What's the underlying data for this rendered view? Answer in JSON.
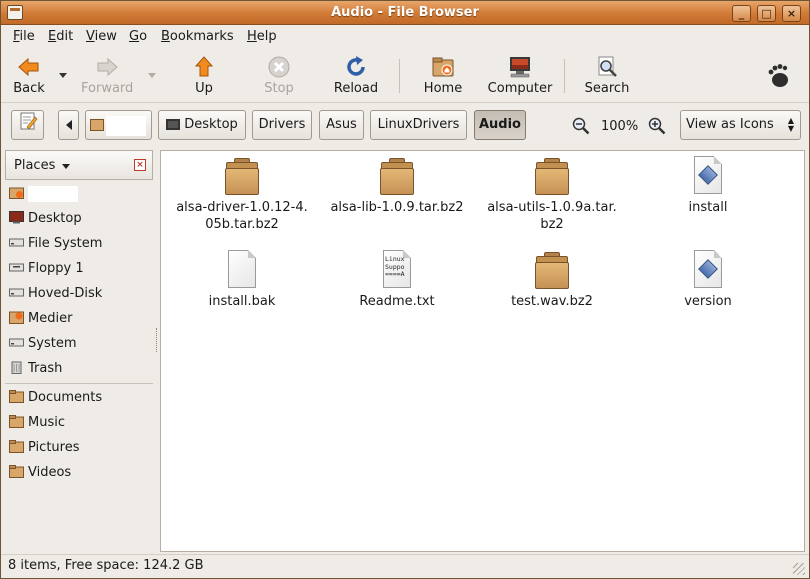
{
  "window": {
    "title": "Audio - File Browser"
  },
  "menu": [
    {
      "label": "File",
      "mnemonic": "F",
      "rest": "ile"
    },
    {
      "label": "Edit",
      "mnemonic": "E",
      "rest": "dit"
    },
    {
      "label": "View",
      "mnemonic": "V",
      "rest": "iew"
    },
    {
      "label": "Go",
      "mnemonic": "G",
      "rest": "o"
    },
    {
      "label": "Bookmarks",
      "mnemonic": "B",
      "rest": "ookmarks"
    },
    {
      "label": "Help",
      "mnemonic": "H",
      "rest": "elp"
    }
  ],
  "toolbar": {
    "back": "Back",
    "forward": "Forward",
    "up": "Up",
    "stop": "Stop",
    "reload": "Reload",
    "home": "Home",
    "computer": "Computer",
    "search": "Search"
  },
  "location": {
    "crumbs": [
      "Desktop",
      "Drivers",
      "Asus",
      "LinuxDrivers",
      "Audio"
    ],
    "active": "Audio",
    "zoom": "100%",
    "view_mode": "View as Icons"
  },
  "sidebar": {
    "header": "Places",
    "items": [
      {
        "label": "",
        "icon": "home-folder-icon"
      },
      {
        "label": "Desktop",
        "icon": "desktop-icon"
      },
      {
        "label": "File System",
        "icon": "drive-icon"
      },
      {
        "label": "Floppy 1",
        "icon": "floppy-icon"
      },
      {
        "label": "Hoved-Disk",
        "icon": "drive-icon"
      },
      {
        "label": "Medier",
        "icon": "media-icon"
      },
      {
        "label": "System",
        "icon": "drive-icon"
      },
      {
        "label": "Trash",
        "icon": "trash-icon"
      }
    ],
    "bookmarks": [
      {
        "label": "Documents",
        "icon": "folder-icon"
      },
      {
        "label": "Music",
        "icon": "folder-icon"
      },
      {
        "label": "Pictures",
        "icon": "folder-icon"
      },
      {
        "label": "Videos",
        "icon": "folder-icon"
      }
    ]
  },
  "files": [
    {
      "name": "alsa-driver-1.0.12-4.05b.tar.bz2",
      "line1": "alsa-driver-1.0.12-4.",
      "line2": "05b.tar.bz2",
      "type": "archive"
    },
    {
      "name": "alsa-lib-1.0.9.tar.bz2",
      "line1": "alsa-lib-1.0.9.tar.bz2",
      "line2": "",
      "type": "archive"
    },
    {
      "name": "alsa-utils-1.0.9a.tar.bz2",
      "line1": "alsa-utils-1.0.9a.tar.",
      "line2": "bz2",
      "type": "archive"
    },
    {
      "name": "install",
      "line1": "install",
      "line2": "",
      "type": "script"
    },
    {
      "name": "install.bak",
      "line1": "install.bak",
      "line2": "",
      "type": "blank"
    },
    {
      "name": "Readme.txt",
      "line1": "Readme.txt",
      "line2": "",
      "type": "text",
      "preview": [
        "Linux",
        "Suppo",
        "====A"
      ]
    },
    {
      "name": "test.wav.bz2",
      "line1": "test.wav.bz2",
      "line2": "",
      "type": "archive"
    },
    {
      "name": "version",
      "line1": "version",
      "line2": "",
      "type": "script"
    }
  ],
  "status": {
    "text": "8 items, Free space: 124.2 GB"
  },
  "colors": {
    "titlebar": "#d07a36",
    "folder": "#c69155",
    "accent": "#e8a56a"
  }
}
